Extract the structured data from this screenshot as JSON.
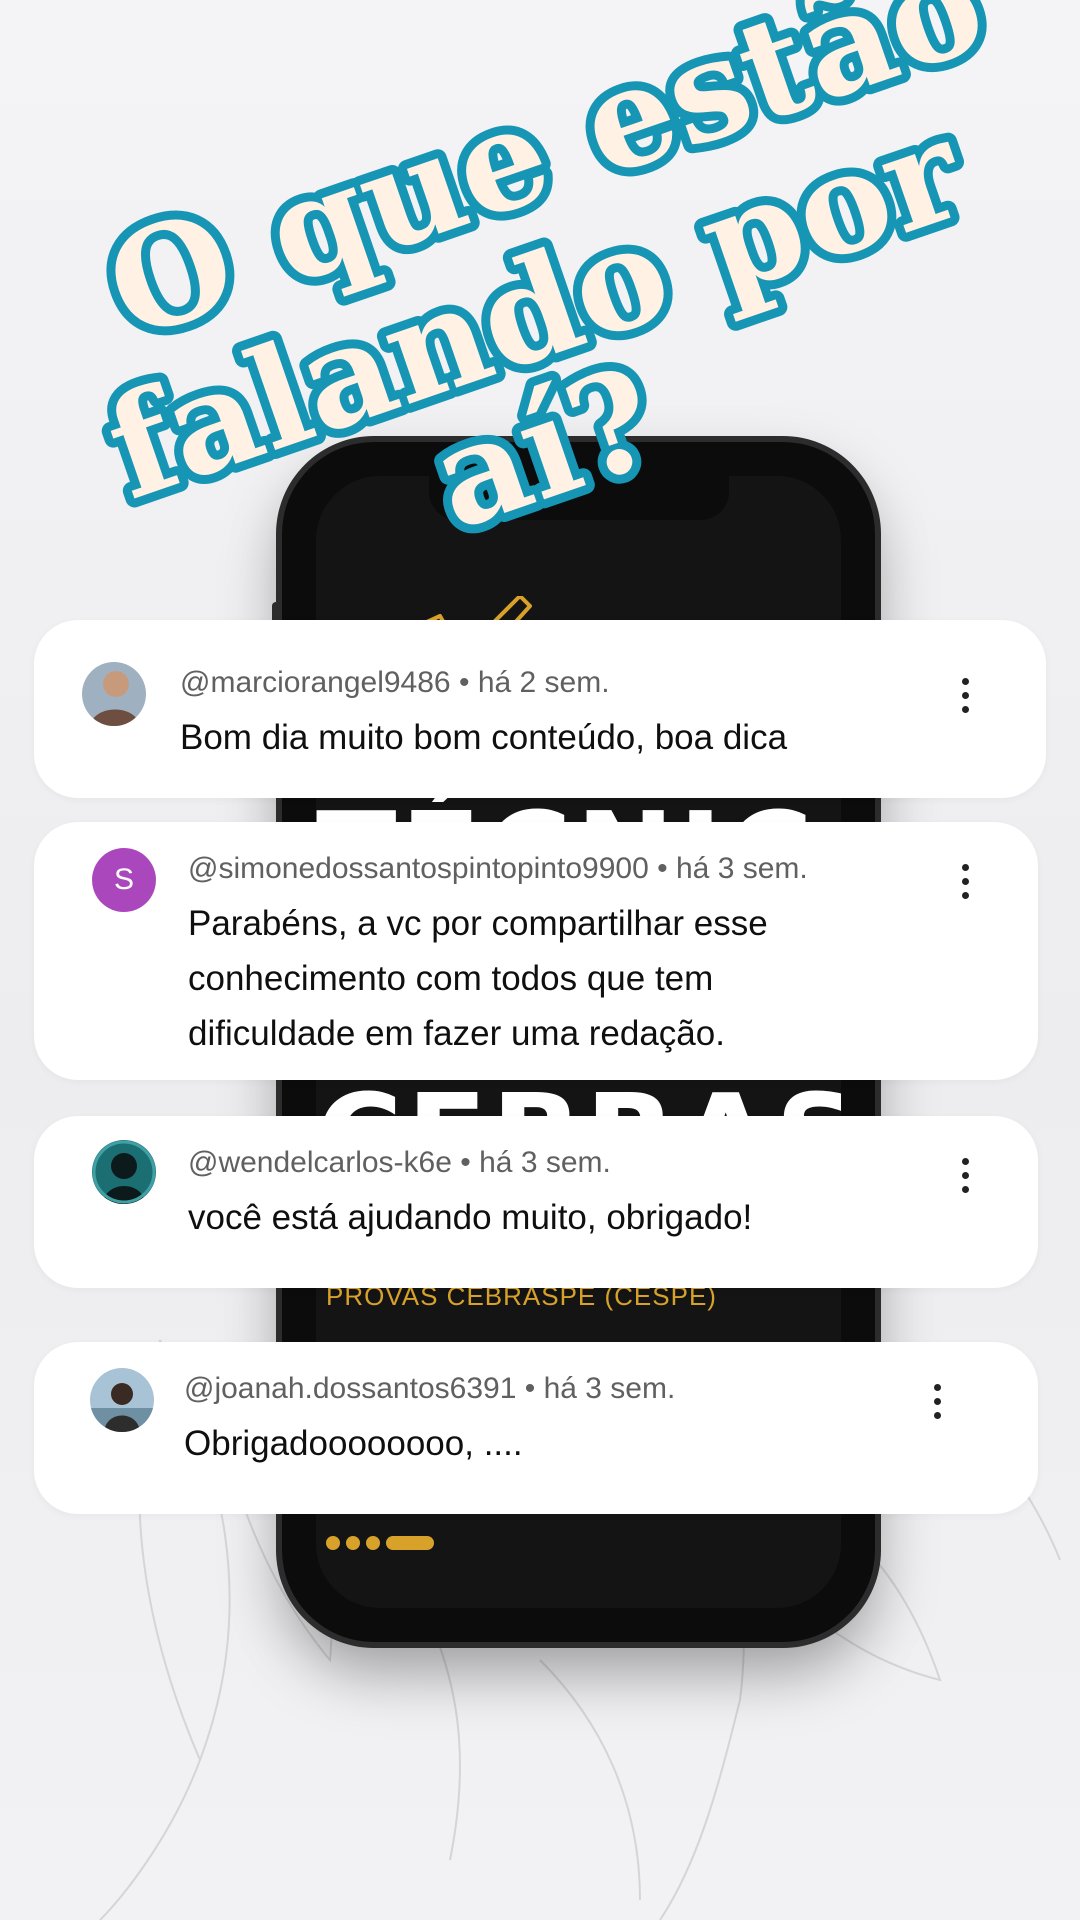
{
  "headline": {
    "line1": "O que estão",
    "line2": "falando por",
    "line3": "aí?"
  },
  "phone_screen": {
    "big_text_1": "TÉCNICA DE",
    "big_text_2": "CEBRASPE",
    "subtitle": "PROVAS CEBRASPE (CESPE)"
  },
  "comments": [
    {
      "handle": "@marciorangel9486",
      "time": "há 2 sem.",
      "text": "Bom dia muito bom conteúdo, boa dica",
      "avatar": {
        "type": "photo",
        "color": "#8a97a6"
      }
    },
    {
      "handle": "@simonedossantospintopinto9900",
      "time": "há 3 sem.",
      "text": "Parabéns, a vc por compartilhar esse conhecimento com todos que tem dificuldade em fazer uma redação.",
      "avatar": {
        "type": "letter",
        "letter": "S",
        "color": "#ab47bc"
      }
    },
    {
      "handle": "@wendelcarlos-k6e",
      "time": "há 3 sem.",
      "text": "você está ajudando muito, obrigado!",
      "avatar": {
        "type": "photo",
        "color": "#1b6f73"
      }
    },
    {
      "handle": "@joanah.dossantos6391",
      "time": "há 3 sem.",
      "text": "Obrigadoooooooo, ....",
      "avatar": {
        "type": "photo",
        "color": "#7fa6c1"
      }
    }
  ],
  "separator": "•",
  "icons": {
    "more": "more-vert-icon"
  }
}
